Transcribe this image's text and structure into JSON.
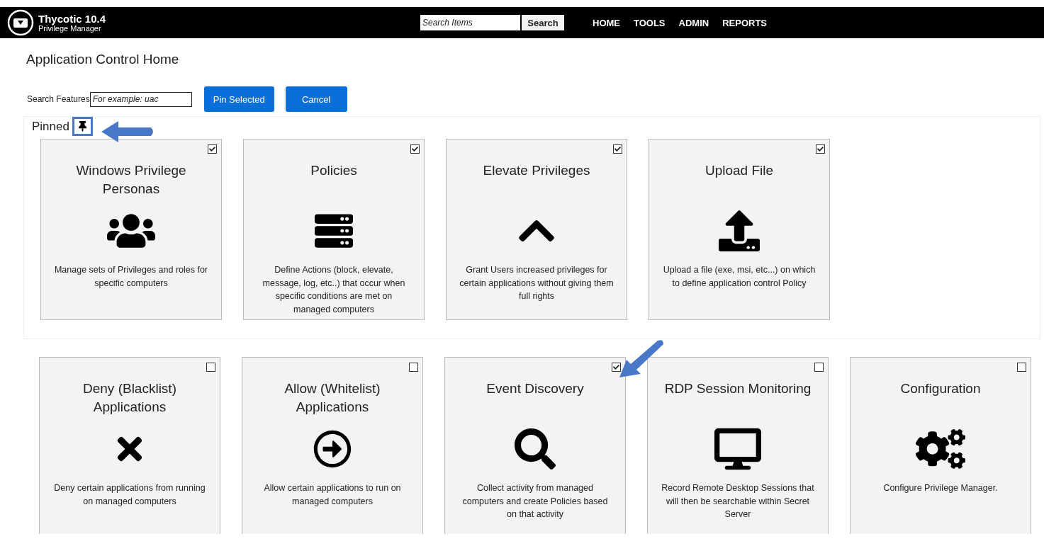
{
  "header": {
    "product": "Thycotic 10.4",
    "subtitle": "Privilege Manager",
    "search": {
      "placeholder": "Search Items",
      "button": "Search"
    },
    "nav": [
      "HOME",
      "TOOLS",
      "ADMIN",
      "REPORTS"
    ]
  },
  "page_title": "Application Control Home",
  "search_features": {
    "label": "Search Features",
    "placeholder": "For example: uac"
  },
  "buttons": [
    "Pin Selected",
    "Cancel"
  ],
  "pinned": {
    "label": "Pinned",
    "cards": [
      {
        "title": "Windows Privilege Personas",
        "description": "Manage sets of Privileges and roles for specific computers",
        "checked": true
      },
      {
        "title": "Policies",
        "description": "Define Actions (block, elevate, message, log, etc..) that occur when specific conditions are met on managed computers",
        "checked": true
      },
      {
        "title": "Elevate Privileges",
        "description": "Grant Users increased privileges for certain applications without giving them full rights",
        "checked": true
      },
      {
        "title": "Upload File",
        "description": "Upload a file (exe, msi, etc...) on which to define application control Policy",
        "checked": true
      }
    ]
  },
  "features": {
    "cards": [
      {
        "title": "Deny (Blacklist) Applications",
        "description": "Deny certain applications from running on managed computers",
        "checked": false
      },
      {
        "title": "Allow (Whitelist) Applications",
        "description": "Allow certain applications to run on managed computers",
        "checked": false
      },
      {
        "title": "Event Discovery",
        "description": "Collect activity from managed computers and create Policies based on that activity",
        "checked": true
      },
      {
        "title": "RDP Session Monitoring",
        "description": "Record Remote Desktop Sessions that will then be searchable within Secret Server",
        "checked": false
      },
      {
        "title": "Configuration",
        "description": "Configure Privilege Manager.",
        "checked": false
      }
    ]
  }
}
